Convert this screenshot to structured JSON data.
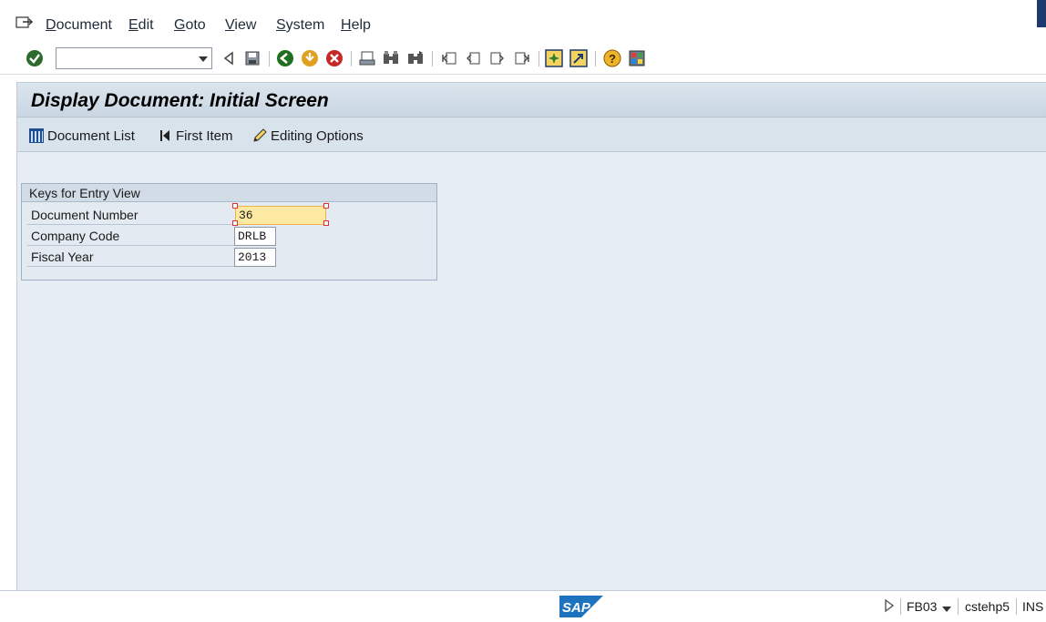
{
  "menu": {
    "items": [
      "Document",
      "Edit",
      "Goto",
      "View",
      "System",
      "Help"
    ]
  },
  "toolbar": {
    "command_field_value": "",
    "icons": [
      "enter-icon",
      "back-icon",
      "save-icon",
      "green-back-icon",
      "exit-icon",
      "cancel-icon",
      "print-icon",
      "find-icon",
      "find-next-icon",
      "first-page-icon",
      "previous-page-icon",
      "next-page-icon",
      "last-page-icon",
      "create-session-icon",
      "create-shortcut-icon",
      "help-icon",
      "customize-layout-icon"
    ]
  },
  "screen": {
    "title": "Display Document: Initial Screen"
  },
  "app_toolbar": {
    "document_list": "Document List",
    "first_item": "First Item",
    "editing_options": "Editing Options"
  },
  "keys_group": {
    "header": "Keys for Entry View",
    "fields": [
      {
        "label": "Document Number",
        "value": "36"
      },
      {
        "label": "Company Code",
        "value": "DRLB"
      },
      {
        "label": "Fiscal Year",
        "value": "2013"
      }
    ]
  },
  "status": {
    "transaction": "FB03",
    "server": "cstehp5",
    "mode": "INS"
  },
  "colors": {
    "focus_field": "#fde9a1",
    "title_bar": "#c9d6e2",
    "sap_logo": "#1e73be"
  }
}
